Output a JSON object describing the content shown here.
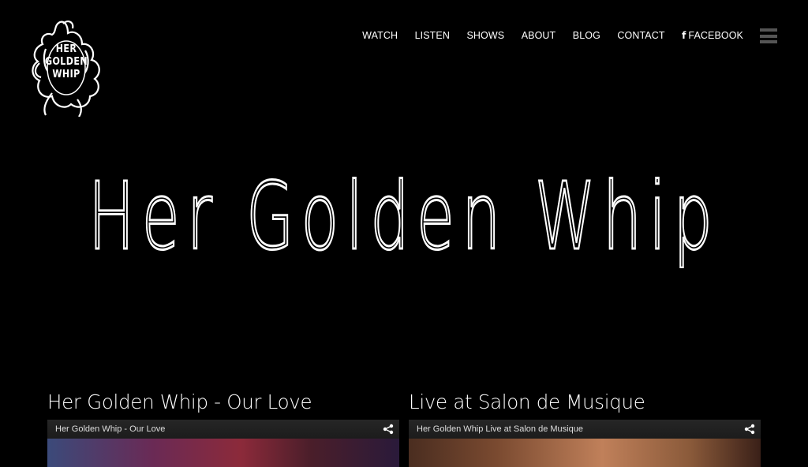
{
  "logo": {
    "lines": [
      "HER",
      "GOLDEN",
      "WHIP"
    ]
  },
  "nav": {
    "items": [
      {
        "label": "WATCH"
      },
      {
        "label": "LISTEN"
      },
      {
        "label": "SHOWS"
      },
      {
        "label": "ABOUT"
      },
      {
        "label": "BLOG"
      },
      {
        "label": "CONTACT"
      },
      {
        "label": "FACEBOOK",
        "icon": "facebook-icon",
        "glyph": "f"
      }
    ],
    "menu_icon": "hamburger-menu-icon"
  },
  "hero": {
    "title": "Her Golden Whip"
  },
  "videos": [
    {
      "heading": "Her Golden Whip - Our Love",
      "player_title": "Her Golden Whip - Our Love"
    },
    {
      "heading": "Live at Salon de Musique",
      "player_title": "Her Golden Whip Live at Salon de Musique"
    }
  ],
  "colors": {
    "background": "#000000",
    "text": "#ffffff",
    "menu_icon": "#555555"
  }
}
